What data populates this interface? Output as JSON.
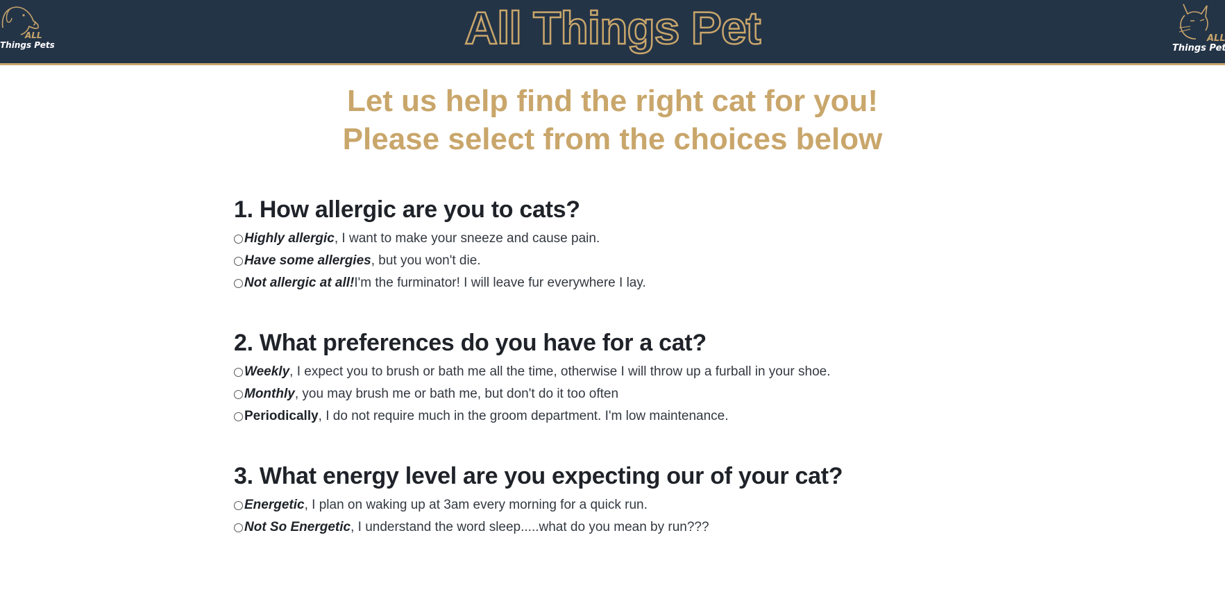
{
  "header": {
    "title": "All Things Pet",
    "logo_left": {
      "icon": "dog-logo-icon",
      "line1": "ALL",
      "line2": "Things Pets"
    },
    "logo_right": {
      "icon": "cat-logo-icon",
      "line1": "ALL",
      "line2": "Things Pets"
    }
  },
  "intro": {
    "line1": "Let us help find the right cat for you!",
    "line2": "Please select from the choices below"
  },
  "questions": [
    {
      "title": "1. How allergic are you to cats?",
      "options": [
        {
          "strong": "Highly allergic",
          "rest": ", I want to make your sneeze and cause pain."
        },
        {
          "strong": "Have some allergies",
          "rest": ", but you won't die."
        },
        {
          "strong": "Not allergic at all!",
          "rest": " I'm the furminator! I will leave fur everywhere I lay."
        }
      ]
    },
    {
      "title": "2. What preferences do you have for a cat?",
      "options": [
        {
          "strong": "Weekly",
          "rest": ", I expect you to brush or bath me all the time, otherwise I will throw up a furball in your shoe."
        },
        {
          "strong": "Monthly",
          "rest": ", you may brush me or bath me, but don't do it too often"
        },
        {
          "strong": "Periodically",
          "rest": ", I do not require much in the groom department. I'm low maintenance."
        }
      ]
    },
    {
      "title": "3. What energy level are you expecting our of your cat?",
      "options": [
        {
          "strong": "Energetic",
          "rest": ", I plan on waking up at 3am every morning for a quick run."
        },
        {
          "strong": "Not So Energetic",
          "rest": ", I understand the word sleep.....what do you mean by run???"
        }
      ]
    }
  ],
  "colors": {
    "header_bg": "#243447",
    "accent_gold": "#c9a66b",
    "text_dark": "#1f2329"
  }
}
